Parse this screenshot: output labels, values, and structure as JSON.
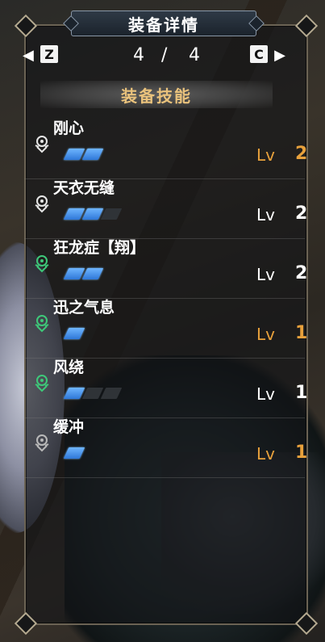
{
  "window": {
    "title": "装备详情"
  },
  "pager": {
    "left_key": "Z",
    "right_key": "C",
    "current": "4",
    "separator": "/",
    "total": "4"
  },
  "section": {
    "title": "装备技能"
  },
  "colors": {
    "accent_gold": "#e8a13c",
    "bar_blue": "#3d8ae6",
    "icon_white": "#e6e6e6",
    "icon_green": "#3ec879"
  },
  "skills": [
    {
      "name": "刚心",
      "icon": "white-skill-icon",
      "bars_on": 2,
      "bars_total": 2,
      "lv_label": "Lv",
      "level": "2",
      "highlight": true
    },
    {
      "name": "天衣无缝",
      "icon": "white-skill-icon",
      "bars_on": 2,
      "bars_total": 3,
      "lv_label": "Lv",
      "level": "2",
      "highlight": false
    },
    {
      "name": "狂龙症【翔】",
      "icon": "green-skill-icon",
      "bars_on": 2,
      "bars_total": 2,
      "lv_label": "Lv",
      "level": "2",
      "highlight": false
    },
    {
      "name": "迅之气息",
      "icon": "green-skill-icon",
      "bars_on": 1,
      "bars_total": 1,
      "lv_label": "Lv",
      "level": "1",
      "highlight": true
    },
    {
      "name": "风绕",
      "icon": "green-skill-icon",
      "bars_on": 1,
      "bars_total": 3,
      "lv_label": "Lv",
      "level": "1",
      "highlight": false
    },
    {
      "name": "缓冲",
      "icon": "gray-skill-icon",
      "bars_on": 1,
      "bars_total": 1,
      "lv_label": "Lv",
      "level": "1",
      "highlight": true
    }
  ]
}
